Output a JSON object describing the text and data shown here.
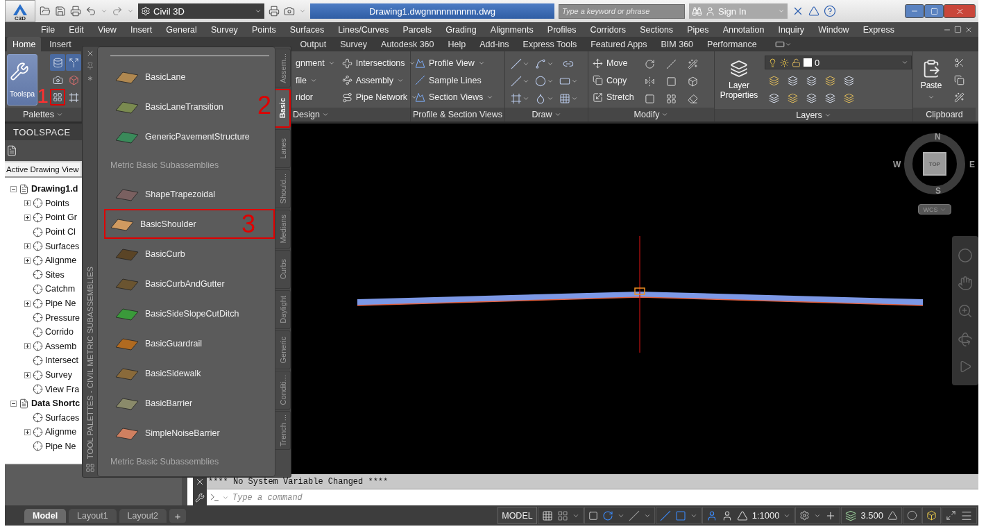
{
  "title_bar": {
    "app_badge": "C3D",
    "workspace": "Civil 3D",
    "document_title": "Drawing1.dwgnnnnnnnnnn.dwg",
    "search": {
      "placeholder": "Type a keyword or phrase"
    },
    "sign_in": "Sign In"
  },
  "menu_bar": [
    "File",
    "Edit",
    "View",
    "Insert",
    "General",
    "Survey",
    "Points",
    "Surfaces",
    "Lines/Curves",
    "Parcels",
    "Grading",
    "Alignments",
    "Profiles",
    "Corridors",
    "Sections",
    "Pipes",
    "Annotation",
    "Inquiry",
    "Window",
    "Express"
  ],
  "ribbon_tabs": [
    {
      "label": "Home",
      "selected": true
    },
    {
      "label": "Insert",
      "selected": false
    },
    {
      "label": "Output",
      "selected": false
    },
    {
      "label": "Survey",
      "selected": false
    },
    {
      "label": "Autodesk 360",
      "selected": false
    },
    {
      "label": "Help",
      "selected": false
    },
    {
      "label": "Add-ins",
      "selected": false
    },
    {
      "label": "Express Tools",
      "selected": false
    },
    {
      "label": "Featured Apps",
      "selected": false
    },
    {
      "label": "BIM 360",
      "selected": false
    },
    {
      "label": "Performance",
      "selected": false
    }
  ],
  "ribbon": {
    "palettes": {
      "big_button": "Toolspa",
      "title": "Palettes",
      "callout": "1"
    },
    "design": {
      "partial_items": [
        "gnment",
        "file",
        "ridor"
      ],
      "items": [
        "Intersections",
        "Assembly",
        "Pipe Network"
      ],
      "title": "Design"
    },
    "profile_section": {
      "items": [
        "Profile View",
        "Sample Lines",
        "Section Views"
      ],
      "title": "Profile & Section Views"
    },
    "draw": {
      "title": "Draw"
    },
    "modify": {
      "items": [
        "Move",
        "Copy",
        "Stretch"
      ],
      "title": "Modify"
    },
    "layers": {
      "big_button": "Layer Properties",
      "current_layer": "0",
      "title": "Layers"
    },
    "clipboard": {
      "big_button": "Paste",
      "title": "Clipboard"
    }
  },
  "toolspace": {
    "title": "TOOLSPACE",
    "tab": "Active Drawing View",
    "tree": [
      {
        "label": "Drawing1.d",
        "expanded": true,
        "children": [
          {
            "label": "Points",
            "expanded": false
          },
          {
            "label": "Point Gr",
            "expanded": false
          },
          {
            "label": "Point Cl"
          },
          {
            "label": "Surfaces",
            "expanded": false
          },
          {
            "label": "Alignme",
            "expanded": false
          },
          {
            "label": "Sites"
          },
          {
            "label": "Catchm"
          },
          {
            "label": "Pipe Ne",
            "expanded": false
          },
          {
            "label": "Pressure"
          },
          {
            "label": "Corrido"
          },
          {
            "label": "Assemb",
            "expanded": false
          },
          {
            "label": "Intersect"
          },
          {
            "label": "Survey",
            "expanded": false
          },
          {
            "label": "View Fra"
          }
        ]
      },
      {
        "label": "Data Shortc",
        "expanded": true,
        "children": [
          {
            "label": "Surfaces"
          },
          {
            "label": "Alignme",
            "expanded": false
          },
          {
            "label": "Pipe Ne"
          }
        ]
      }
    ]
  },
  "tool_palette": {
    "title": "TOOL PALETTES - CIVIL METRIC SUBASSEMBLIES",
    "items": [
      {
        "kind": "tool",
        "label": "BasicLane"
      },
      {
        "kind": "tool",
        "label": "BasicLaneTransition"
      },
      {
        "kind": "tool",
        "label": "GenericPavementStructure"
      },
      {
        "kind": "header",
        "label": "Metric Basic Subassemblies"
      },
      {
        "kind": "tool",
        "label": "ShapeTrapezoidal"
      },
      {
        "kind": "tool",
        "label": "BasicShoulder",
        "callout": "3"
      },
      {
        "kind": "tool",
        "label": "BasicCurb"
      },
      {
        "kind": "tool",
        "label": "BasicCurbAndGutter"
      },
      {
        "kind": "tool",
        "label": "BasicSideSlopeCutDitch"
      },
      {
        "kind": "tool",
        "label": "BasicGuardrail"
      },
      {
        "kind": "tool",
        "label": "BasicSidewalk"
      },
      {
        "kind": "tool",
        "label": "BasicBarrier"
      },
      {
        "kind": "tool",
        "label": "SimpleNoiseBarrier"
      },
      {
        "kind": "header",
        "label": "Metric Basic Subassemblies"
      }
    ],
    "tabs": [
      {
        "label": "Assem...",
        "selected": false
      },
      {
        "label": "Basic",
        "selected": true,
        "callout": "2"
      },
      {
        "label": "Lanes",
        "selected": false
      },
      {
        "label": "Should...",
        "selected": false
      },
      {
        "label": "Medians",
        "selected": false
      },
      {
        "label": "Curbs",
        "selected": false
      },
      {
        "label": "Daylight",
        "selected": false
      },
      {
        "label": "Generic",
        "selected": false
      },
      {
        "label": "Conditi...",
        "selected": false
      },
      {
        "label": "Trench ...",
        "selected": false
      }
    ]
  },
  "viewcube": {
    "north": "N",
    "east": "E",
    "south": "S",
    "west": "W",
    "face": "TOP",
    "ucs": "WCS"
  },
  "command_line": {
    "history": "**** No System Variable Changed ****",
    "placeholder": "Type a command"
  },
  "layout_tabs": [
    {
      "label": "Model",
      "selected": true
    },
    {
      "label": "Layout1",
      "selected": false
    },
    {
      "label": "Layout2",
      "selected": false
    }
  ],
  "add_layout": "+",
  "status_bar": {
    "mode": "MODEL",
    "annotation_scale": "1:1000",
    "readout": "3.500"
  }
}
